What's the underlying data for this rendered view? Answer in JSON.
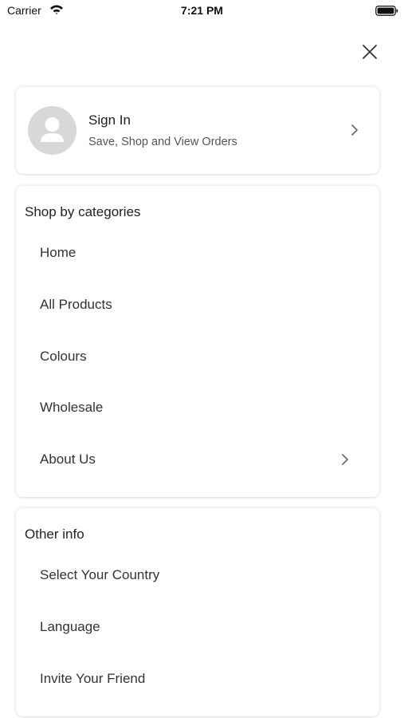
{
  "status_bar": {
    "carrier": "Carrier",
    "time": "7:21 PM"
  },
  "close_icon": "close-icon",
  "sign_in": {
    "title": "Sign In",
    "subtitle": "Save, Shop and View Orders",
    "avatar_icon": "user-placeholder-icon"
  },
  "categories": {
    "title": "Shop by categories",
    "items": [
      {
        "label": "Home"
      },
      {
        "label": "All Products"
      },
      {
        "label": "Colours"
      },
      {
        "label": "Wholesale"
      },
      {
        "label": "About Us",
        "has_chevron": true
      }
    ]
  },
  "other_info": {
    "title": "Other info",
    "items": [
      {
        "label": "Select Your Country"
      },
      {
        "label": "Language"
      },
      {
        "label": "Invite Your Friend"
      }
    ]
  },
  "colors": {
    "background": "#ffffff",
    "avatar_bg": "#d8d8d8",
    "chevron": "#6e6e6e"
  }
}
